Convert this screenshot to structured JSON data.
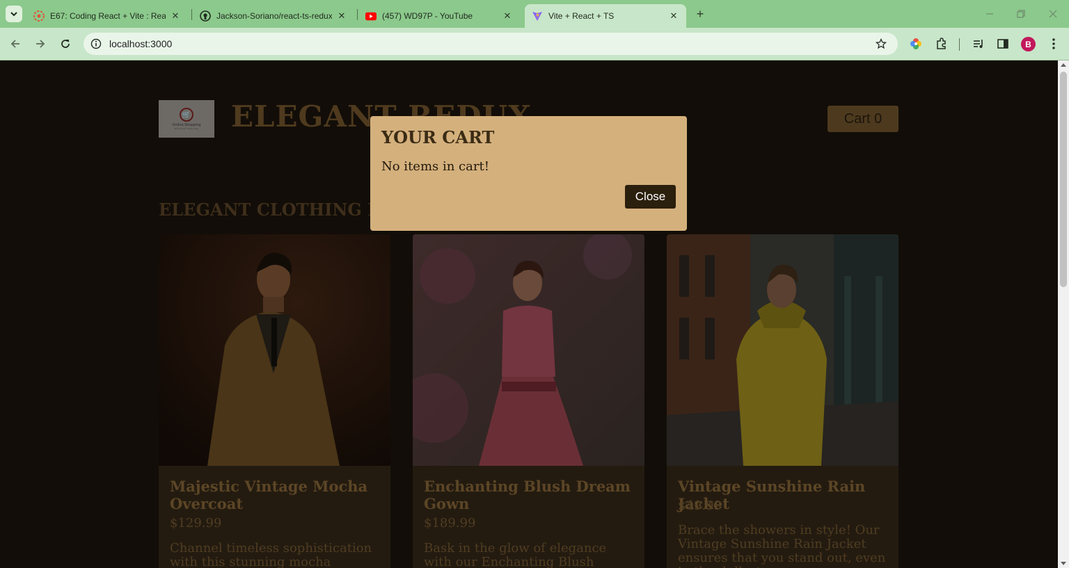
{
  "browser": {
    "tabs": [
      {
        "title": "E67: Coding React + Vite : Reac",
        "icon": "udemy-icon"
      },
      {
        "title": "Jackson-Soriano/react-ts-redux",
        "icon": "github-icon"
      },
      {
        "title": "(457) WD97P - YouTube",
        "icon": "youtube-icon"
      },
      {
        "title": "Vite + React + TS",
        "icon": "vite-icon"
      }
    ],
    "url": "localhost:3000",
    "profile_initial": "B",
    "colors": {
      "frame": "#8cc98c",
      "toolbar": "#c8e6c9"
    }
  },
  "header": {
    "logo_text": "Online Shopping",
    "logo_subtext": "Shop smart. Shop easy.",
    "title": "ELEGANT REDUX",
    "cart_label": "Cart 0"
  },
  "section": {
    "title": "ELEGANT CLOTHING FOR"
  },
  "products": [
    {
      "name": "Majestic Vintage Mocha Overcoat",
      "price": "$129.99",
      "description": "Channel timeless sophistication with this stunning mocha overcoat."
    },
    {
      "name": "Enchanting Blush Dream Gown",
      "price": "$189.99",
      "description": "Bask in the glow of elegance with our Enchanting Blush Dream Gown."
    },
    {
      "name": "Vintage Sunshine Rain Jacket",
      "price": "$49.99",
      "description": "Brace the showers in style! Our Vintage Sunshine Rain Jacket ensures that you stand out, even in the dullest"
    }
  ],
  "modal": {
    "title": "YOUR CART",
    "message": "No items in cart!",
    "close_label": "Close"
  },
  "theme": {
    "page_bg": "#120d08",
    "card_bg": "#241b10",
    "modal_bg": "#d4b07c",
    "close_button_bg": "#2b1f0d"
  }
}
